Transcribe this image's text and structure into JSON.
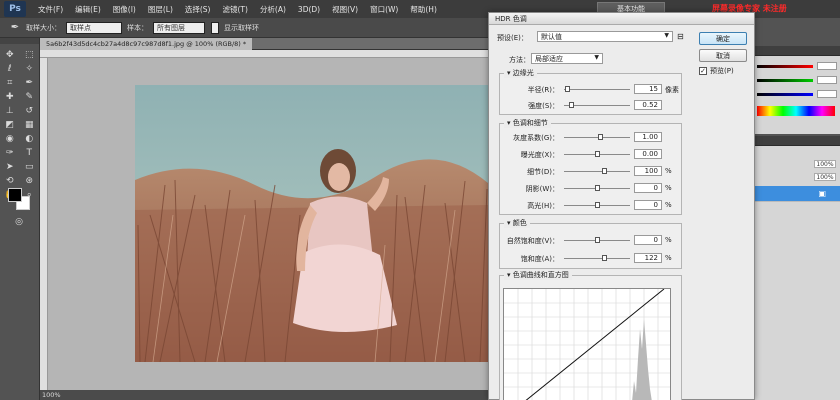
{
  "app": {
    "logo": "Ps"
  },
  "menu": [
    "文件(F)",
    "编辑(E)",
    "图像(I)",
    "图层(L)",
    "选择(S)",
    "滤镜(T)",
    "分析(A)",
    "3D(D)",
    "视图(V)",
    "窗口(W)",
    "帮助(H)"
  ],
  "workspace_button": "基本功能",
  "recorder_banner": "屏幕录像专家 未注册",
  "options_bar": {
    "label_size": "取样大小：",
    "size_value": "取样点",
    "label_sample": "样本：",
    "sample_value": "所有图层",
    "checkbox_label": "显示取样环"
  },
  "document": {
    "tab_title": "5a6b2f43d5dc4cb27a4d8c97c987d8f1.jpg @ 100% (RGB/8) *",
    "zoom": "100%"
  },
  "dialog": {
    "title": "HDR 色调",
    "preset_label": "预设(E)：",
    "preset_value": "默认值",
    "method_label": "方法：",
    "method_value": "局部适应",
    "buttons": {
      "ok": "确定",
      "cancel": "取消"
    },
    "preview_label": "预览(P)",
    "edge_glow": {
      "title": "边缘光",
      "radius": {
        "label": "半径(R)：",
        "value": "15",
        "unit": "像素",
        "pos": 0.05
      },
      "strength": {
        "label": "强度(S)：",
        "value": "0.52",
        "unit": "",
        "pos": 0.1
      }
    },
    "tone_detail": {
      "title": "色调和细节",
      "gamma": {
        "label": "灰度系数(G)：",
        "value": "1.00",
        "unit": "",
        "pos": 0.55
      },
      "exposure": {
        "label": "曝光度(X)：",
        "value": "0.00",
        "unit": "",
        "pos": 0.5
      },
      "detail": {
        "label": "细节(D)：",
        "value": "100",
        "unit": "%",
        "pos": 0.6
      },
      "shadow": {
        "label": "阴影(W)：",
        "value": "0",
        "unit": "%",
        "pos": 0.5
      },
      "highlight": {
        "label": "高光(H)：",
        "value": "0",
        "unit": "%",
        "pos": 0.5
      }
    },
    "color": {
      "title": "颜色",
      "vibrance": {
        "label": "自然饱和度(V)：",
        "value": "0",
        "unit": "%",
        "pos": 0.5
      },
      "saturation": {
        "label": "饱和度(A)：",
        "value": "122",
        "unit": "%",
        "pos": 0.61
      }
    },
    "curve": {
      "title": "色调曲线和直方图"
    }
  },
  "layers": {
    "opacity": "100%",
    "fill": "100%"
  },
  "colors": {
    "accent": "#3d8ede",
    "recorder": "#ff2a2a"
  }
}
